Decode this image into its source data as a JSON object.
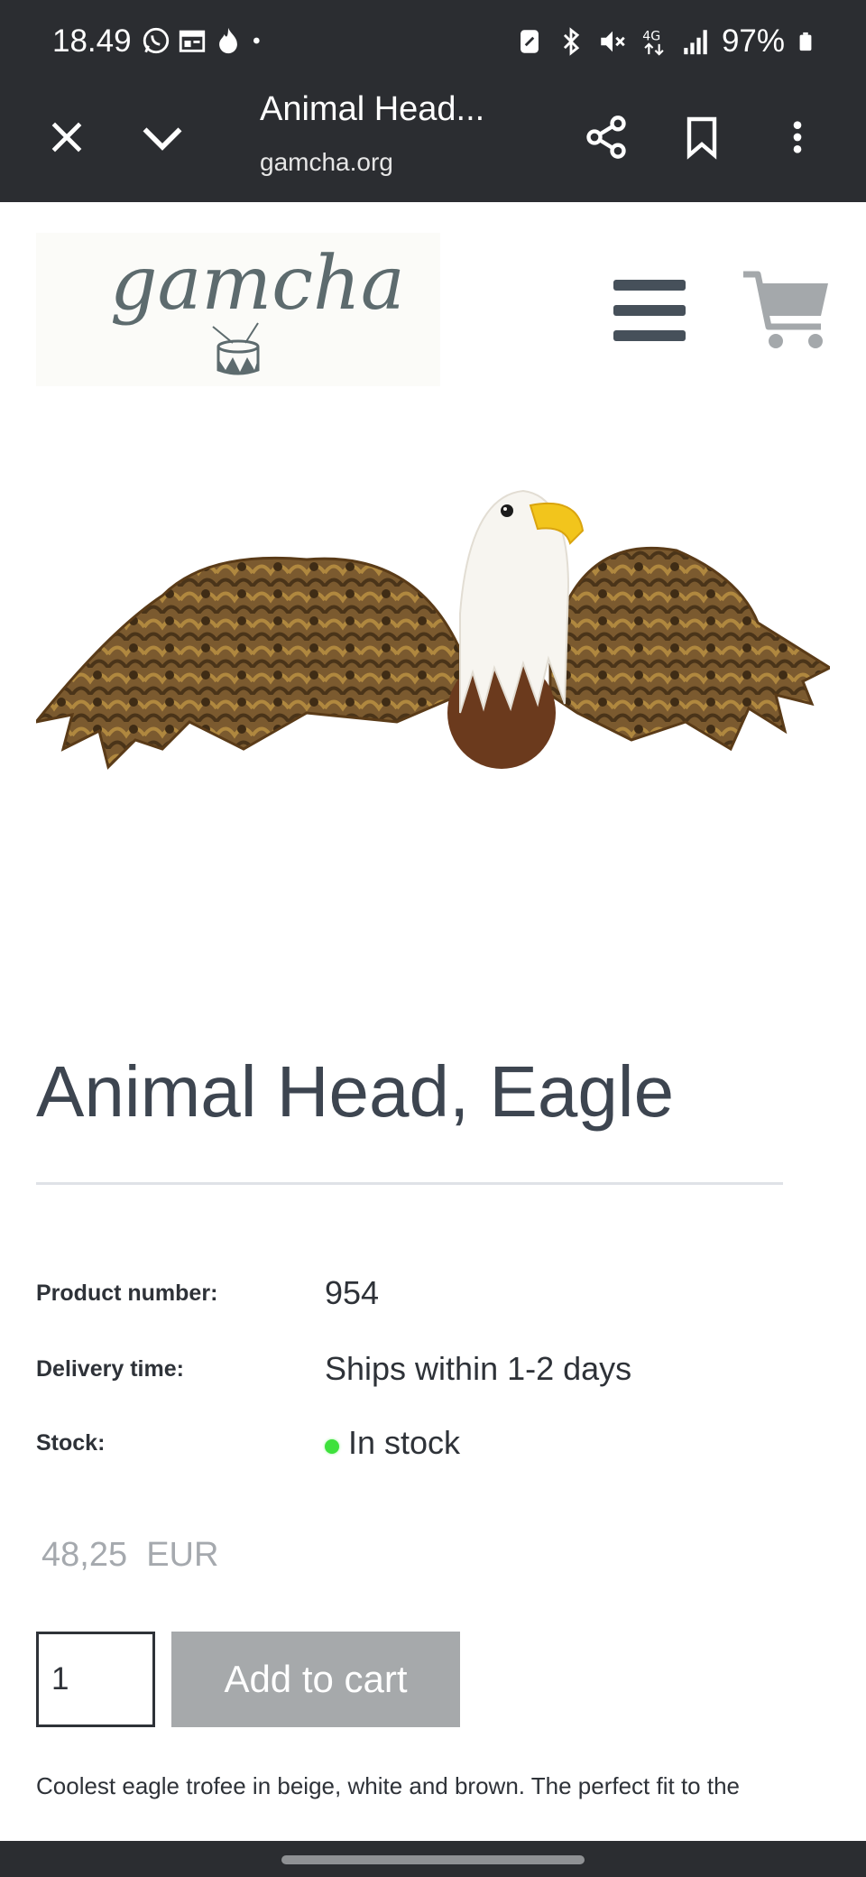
{
  "status_bar": {
    "time": "18.49",
    "battery": "97%",
    "network": "4G",
    "left_icons": [
      "whatsapp-icon",
      "calendar-icon",
      "flame-icon",
      "dot-icon"
    ],
    "right_icons": [
      "nfc-icon",
      "bluetooth-icon",
      "mute-icon",
      "network-4g-icon",
      "signal-icon",
      "battery-icon"
    ]
  },
  "browser": {
    "title": "Animal Head...",
    "url": "gamcha.org"
  },
  "site": {
    "logo_text": "gamcha"
  },
  "product": {
    "title": "Animal Head, Eagle",
    "props": {
      "product_number_label": "Product number:",
      "product_number": "954",
      "delivery_label": "Delivery time:",
      "delivery": "Ships within 1-2 days",
      "stock_label": "Stock:",
      "stock": "In stock"
    },
    "price": "48,25  EUR",
    "quantity": "1",
    "add_to_cart": "Add to cart",
    "description": "Coolest eagle trofee in beige, white and brown. The perfect fit to the"
  },
  "colors": {
    "chrome": "#2b2d31",
    "text": "#3d4550",
    "stock_green": "#3ee13c",
    "button_disabled": "#a6a9ab"
  }
}
